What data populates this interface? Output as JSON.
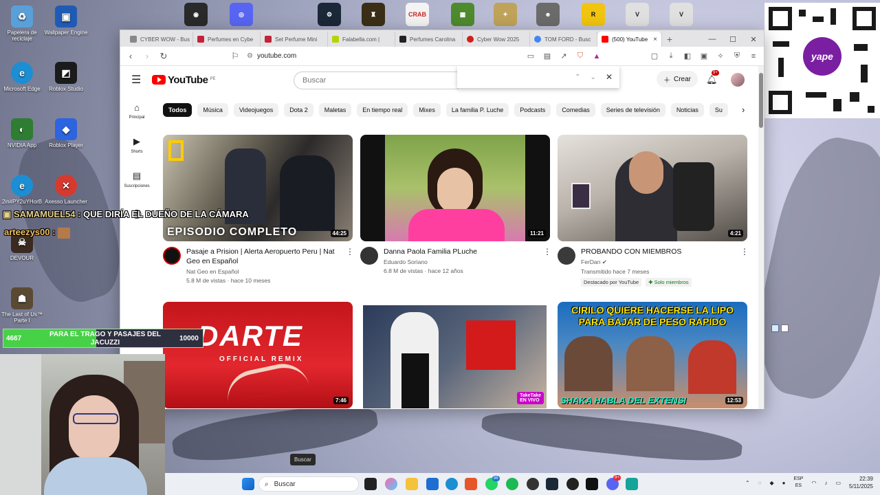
{
  "desktop": {
    "icons": [
      {
        "label": "Papelera de reciclaje",
        "color": "#5aa0d8"
      },
      {
        "label": "Wallpaper Engine",
        "color": "#1f5bb5"
      },
      {
        "label": "Microsoft Edge",
        "color": "#1c8ed4"
      },
      {
        "label": "Roblox Studio",
        "color": "#1b1b1b"
      },
      {
        "label": "NVIDIA App",
        "color": "#2e7d32"
      },
      {
        "label": "Roblox Player",
        "color": "#2d64e0"
      },
      {
        "label": "2in#PY2uYHorB",
        "color": "#1c8ed4"
      },
      {
        "label": "Axesso Launcher",
        "color": "#d63a2f"
      },
      {
        "label": "DEVOUR",
        "color": "#3a2a20"
      },
      {
        "label": "The Last of Us™ Parte I",
        "color": "#5b4a33"
      }
    ]
  },
  "browser": {
    "tabs": [
      {
        "label": "CYBER WOW - Bus",
        "color": "#888888"
      },
      {
        "label": "Perfumes en Cybe",
        "color": "#c2223a"
      },
      {
        "label": "Set Perfume Mini",
        "color": "#c2223a"
      },
      {
        "label": "Falabella.com |",
        "color": "#b7d400"
      },
      {
        "label": "Perfumes Carolina",
        "color": "#222222"
      },
      {
        "label": "Cyber Wow 2025",
        "color": "#d0201a"
      },
      {
        "label": "TOM FORD - Busc",
        "color": "#4285f4"
      },
      {
        "label": "(500) YouTube",
        "color": "#ff0000"
      }
    ],
    "url": "youtube.com"
  },
  "youtube": {
    "logo_text": "YouTube",
    "region": "PE",
    "search_placeholder": "Buscar",
    "create_label": "Crear",
    "notif_count": "9+",
    "guide": [
      {
        "label": "Principal",
        "icon": "home-icon"
      },
      {
        "label": "Shorts",
        "icon": "shorts-icon"
      },
      {
        "label": "Suscripciones",
        "icon": "subscriptions-icon"
      }
    ],
    "chips": [
      "Todos",
      "Música",
      "Videojuegos",
      "Dota 2",
      "Maletas",
      "En tiempo real",
      "Mixes",
      "La familia P. Luche",
      "Podcasts",
      "Comedias",
      "Series de televisión",
      "Noticias",
      "Su"
    ],
    "videos": [
      {
        "title": "Pasaje a Prision | Alerta Aeropuerto Peru | Nat Geo en Español",
        "channel": "Nat Geo en Español",
        "stats": "5.8 M de vistas · hace 10 meses",
        "duration": "44:25",
        "overlay": "EPISODIO COMPLETO"
      },
      {
        "title": "Danna Paola Familia PLuche",
        "channel": "Eduardo Soriano",
        "stats": "6.8 M de vistas · hace 12 años",
        "duration": "11:21",
        "overlay": ""
      },
      {
        "title": "PROBANDO CON MIEMBROS",
        "channel": "FerDan",
        "stats": "Transmitido hace 7 meses",
        "duration": "4:21",
        "overlay": "",
        "tag1": "Destacado por YouTube",
        "tag2": "Solo miembros"
      },
      {
        "title": "",
        "channel": "",
        "stats": "",
        "duration": "7:46",
        "overlay": "DARTE"
      },
      {
        "title": "",
        "channel": "",
        "stats": "",
        "duration": "EN VIVO",
        "overlay": "TakeTake"
      },
      {
        "title": "",
        "channel": "",
        "stats": "",
        "duration": "12:53",
        "overlay": "CIRILO QUIERE HACERSE LA LIPO PARA BAJAR DE PESO RAPIDO"
      }
    ],
    "thumb3_bottom": "SHAKA HABLA DEL EXTENSI",
    "darte_sub": "OFFICIAL REMIX"
  },
  "stream": {
    "chat": [
      {
        "user": "SAMAMUEL54",
        "message": "QUE DIRÍA EL DUEÑO DE LA CÁMARA"
      },
      {
        "user": "arteezys00",
        "message": ""
      }
    ],
    "goal": {
      "current": "4667",
      "target": "10000",
      "text": "PARA EL TRAGO Y PASAJES DEL JACUZZI",
      "progress": 0.4667
    },
    "qr_label": "yape"
  },
  "taskbar": {
    "search_placeholder": "Buscar",
    "tooltip": "Buscar",
    "badges": [
      "86",
      "9+"
    ],
    "lang_top": "ESP",
    "lang_bottom": "ES",
    "time": "22:39",
    "date": "5/11/2025"
  }
}
